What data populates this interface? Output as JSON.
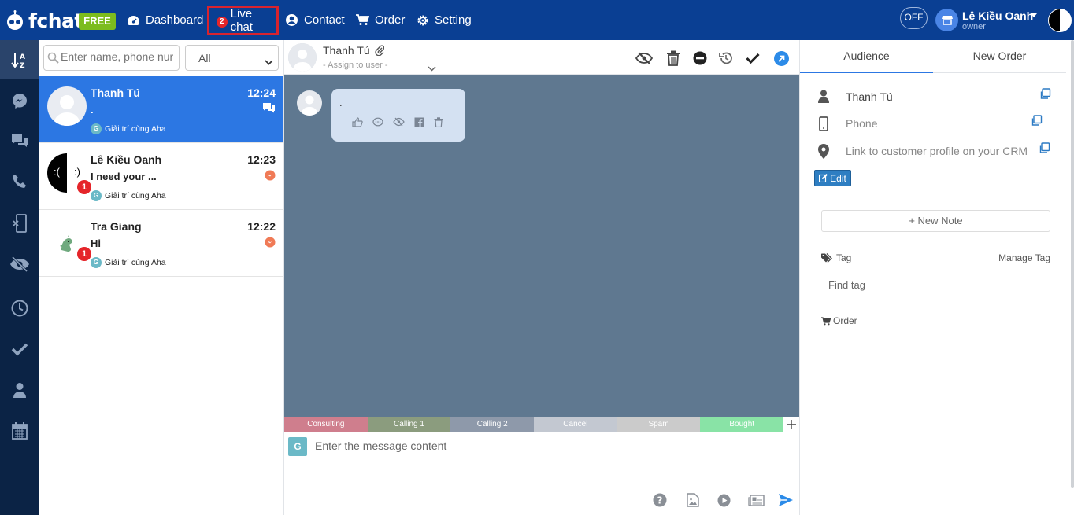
{
  "app": {
    "logo_text": "fchat",
    "plan_badge": "FREE"
  },
  "nav": {
    "dashboard": "Dashboard",
    "live_chat": "Live chat",
    "live_chat_count": "2",
    "contact": "Contact",
    "order": "Order",
    "setting": "Setting"
  },
  "user": {
    "status_toggle": "OFF",
    "name": "Lê Kiều Oanh",
    "role": "owner"
  },
  "sidebar_icons": [
    "sort-az-icon",
    "messenger-icon",
    "comments-icon",
    "phone-icon",
    "mobile-exit-icon",
    "eye-slash-icon",
    "clock-icon",
    "check-icon",
    "user-icon",
    "calendar-icon"
  ],
  "conversation_list": {
    "search_placeholder": "Enter name, phone nur",
    "filter_value": "All",
    "items": [
      {
        "name": "Thanh Tú",
        "time": "12:24",
        "preview": ".",
        "page": "Giải trí cùng Aha",
        "channel": "comment-icon",
        "unread": ""
      },
      {
        "name": "Lê Kiều Oanh",
        "time": "12:23",
        "preview": "I need your ...",
        "page": "Giải trí cùng Aha",
        "channel": "messenger-icon",
        "unread": "1",
        "avatar_left": ":(",
        "avatar_right": ":)"
      },
      {
        "name": "Tra Giang",
        "time": "12:22",
        "preview": "Hi",
        "page": "Giải trí cùng Aha",
        "channel": "messenger-icon",
        "unread": "1"
      }
    ]
  },
  "chat": {
    "contact_name": "Thanh Tú",
    "assign_placeholder": "- Assign to user -",
    "message_text": ".",
    "quick_tags": [
      {
        "label": "Consulting",
        "color": "#cf7e8d"
      },
      {
        "label": "Calling 1",
        "color": "#8b9c7e"
      },
      {
        "label": "Calling 2",
        "color": "#8e99aa"
      },
      {
        "label": "Cancel",
        "color": "#c3c8d1"
      },
      {
        "label": "Spam",
        "color": "#cbcbcb"
      },
      {
        "label": "Bought",
        "color": "#89e3a6"
      }
    ],
    "input_placeholder": "Enter the message content",
    "page_initial": "G"
  },
  "right_panel": {
    "tab_audience": "Audience",
    "tab_new_order": "New Order",
    "customer_name": "Thanh Tú",
    "phone_placeholder": "Phone",
    "crm_link": "Link to customer profile on your CRM",
    "edit_label": "Edit",
    "new_note_label": "+ New Note",
    "tag_label": "Tag",
    "manage_tag_label": "Manage Tag",
    "find_tag_placeholder": "Find tag",
    "order_label": "Order"
  },
  "colors": {
    "topbar": "#0a3f93",
    "sidebar": "#0b2345",
    "accent": "#2c77e3",
    "chat_bg": "#5f7890",
    "badge_red": "#e5252a",
    "free_green": "#7cbc1e"
  }
}
